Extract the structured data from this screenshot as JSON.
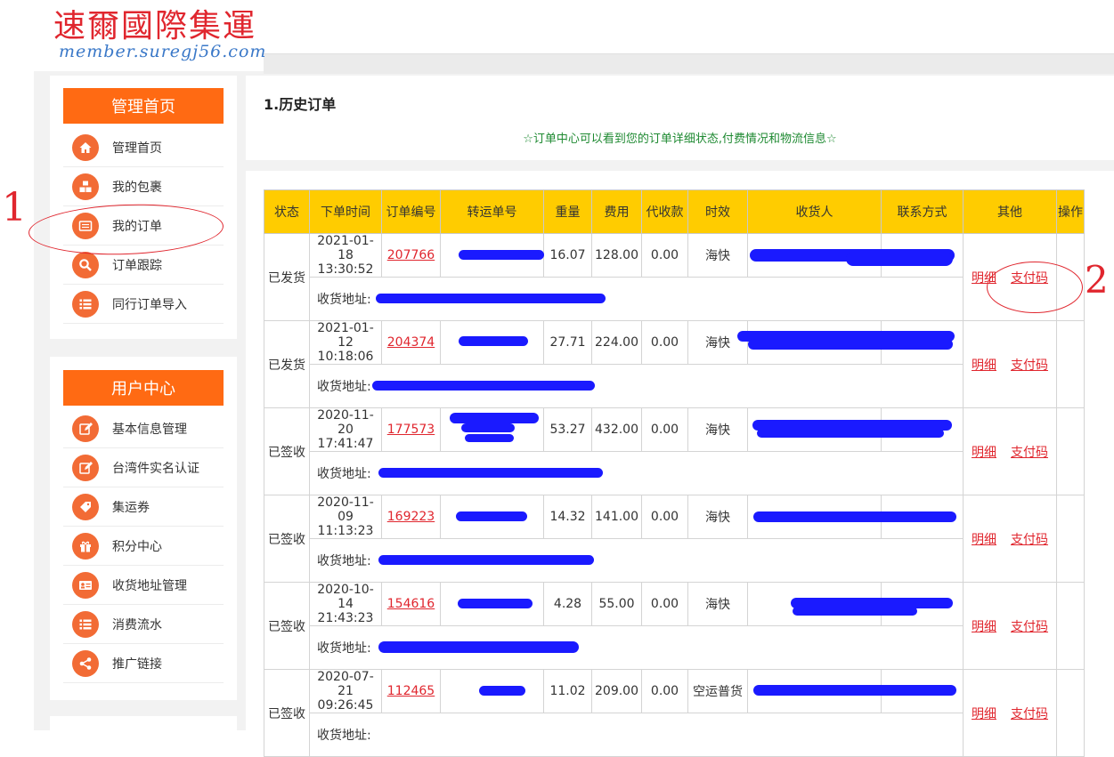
{
  "brand": {
    "name_cn": "速爾國際集運",
    "domain": "member.suregj56.com"
  },
  "sidebar": {
    "management": {
      "title": "管理首页",
      "items": [
        {
          "label": "管理首页",
          "icon": "home-icon"
        },
        {
          "label": "我的包裹",
          "icon": "boxes-icon"
        },
        {
          "label": "我的订单",
          "icon": "order-icon"
        },
        {
          "label": "订单跟踪",
          "icon": "search-icon"
        },
        {
          "label": "同行订单导入",
          "icon": "list-icon"
        }
      ]
    },
    "user_center": {
      "title": "用户中心",
      "items": [
        {
          "label": "基本信息管理",
          "icon": "edit-icon"
        },
        {
          "label": "台湾件实名认证",
          "icon": "edit-icon"
        },
        {
          "label": "集运券",
          "icon": "tag-icon"
        },
        {
          "label": "积分中心",
          "icon": "gift-icon"
        },
        {
          "label": "收货地址管理",
          "icon": "address-card-icon"
        },
        {
          "label": "消费流水",
          "icon": "list-icon"
        },
        {
          "label": "推广链接",
          "icon": "share-icon"
        }
      ]
    }
  },
  "main": {
    "title": "1.历史订单",
    "notice": "☆订单中心可以看到您的订单详细状态,付费情况和物流信息☆",
    "table": {
      "headers": [
        "状态",
        "下单时间",
        "订单编号",
        "转运单号",
        "重量",
        "费用",
        "代收款",
        "时效",
        "收货人",
        "联系方式",
        "其他",
        "操作"
      ],
      "address_label": "收货地址:",
      "action_detail": "明细",
      "action_pay": "支付码",
      "rows": [
        {
          "status": "已发货",
          "date": "2021-01-18",
          "time": "13:30:52",
          "order_no": "207766",
          "weight": "16.07",
          "fee": "128.00",
          "cod": "0.00",
          "mode": "海快"
        },
        {
          "status": "已发货",
          "date": "2021-01-12",
          "time": "10:18:06",
          "order_no": "204374",
          "weight": "27.71",
          "fee": "224.00",
          "cod": "0.00",
          "mode": "海快"
        },
        {
          "status": "已签收",
          "date": "2020-11-20",
          "time": "17:41:47",
          "order_no": "177573",
          "weight": "53.27",
          "fee": "432.00",
          "cod": "0.00",
          "mode": "海快"
        },
        {
          "status": "已签收",
          "date": "2020-11-09",
          "time": "11:13:23",
          "order_no": "169223",
          "weight": "14.32",
          "fee": "141.00",
          "cod": "0.00",
          "mode": "海快"
        },
        {
          "status": "已签收",
          "date": "2020-10-14",
          "time": "21:43:23",
          "order_no": "154616",
          "weight": "4.28",
          "fee": "55.00",
          "cod": "0.00",
          "mode": "海快"
        },
        {
          "status": "已签收",
          "date": "2020-07-21",
          "time": "09:26:45",
          "order_no": "112465",
          "weight": "11.02",
          "fee": "209.00",
          "cod": "0.00",
          "mode": "空运普货"
        }
      ]
    }
  },
  "annotations": {
    "mark_1": "1",
    "mark_2": "2"
  },
  "colors": {
    "brand_red": "#e0262e",
    "brand_blue": "#3a78c8",
    "accent_orange": "#ff6a13",
    "header_yellow": "#ffcc00",
    "notice_green": "#1f8a32",
    "redaction_blue": "#1a1aff"
  }
}
